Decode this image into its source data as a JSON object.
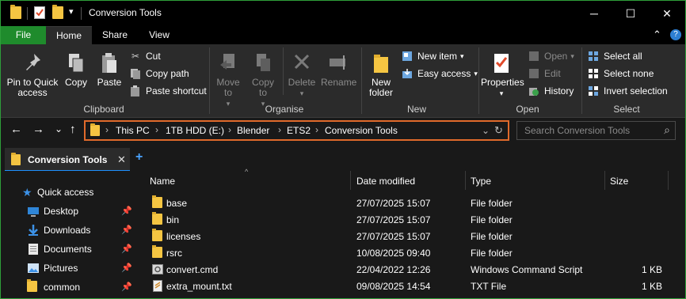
{
  "window": {
    "title": "Conversion Tools",
    "accent": "#2e9e3a",
    "controls": {
      "minimize": "─",
      "maximize": "☐",
      "close": "✕"
    }
  },
  "quick_access_toolbar": {
    "dropdown_glyph": "▾"
  },
  "menu_tabs": [
    {
      "label": "File"
    },
    {
      "label": "Home"
    },
    {
      "label": "Share"
    },
    {
      "label": "View"
    }
  ],
  "ribbon_controls": {
    "collapse_glyph": "⌃",
    "help_glyph": "?"
  },
  "ribbon": {
    "clipboard": {
      "group_label": "Clipboard",
      "pin_label": "Pin to Quick access",
      "copy_label": "Copy",
      "paste_label": "Paste",
      "cut_label": "Cut",
      "copy_path_label": "Copy path",
      "paste_shortcut_label": "Paste shortcut"
    },
    "organise": {
      "group_label": "Organise",
      "move_to_label": "Move to",
      "copy_to_label": "Copy to",
      "delete_label": "Delete",
      "rename_label": "Rename"
    },
    "new": {
      "group_label": "New",
      "new_folder_label": "New folder",
      "new_item_label": "New item",
      "easy_access_label": "Easy access"
    },
    "open": {
      "group_label": "Open",
      "properties_label": "Properties",
      "open_label": "Open",
      "edit_label": "Edit",
      "history_label": "History"
    },
    "select": {
      "group_label": "Select",
      "select_all_label": "Select all",
      "select_none_label": "Select none",
      "invert_label": "Invert selection"
    }
  },
  "address": {
    "crumbs": [
      "This PC",
      "1TB HDD (E:)",
      "Blender",
      "ETS2",
      "Conversion Tools"
    ],
    "separator": "›",
    "highlight_color": "#e06a2b"
  },
  "nav_buttons": {
    "back": "←",
    "forward": "→",
    "recent": "⌄",
    "up": "↑",
    "dropdown": "⌄",
    "refresh": "↻"
  },
  "search": {
    "placeholder": "Search Conversion Tools",
    "icon": "⌕"
  },
  "folder_tab": {
    "label": "Conversion Tools",
    "close_glyph": "✕",
    "new_tab_glyph": "+"
  },
  "nav_pane": {
    "pin_glyph": "📌",
    "items": [
      {
        "label": "Quick access",
        "icon": "star-icon",
        "pinned": false
      },
      {
        "label": "Desktop",
        "icon": "desktop-icon",
        "pinned": true
      },
      {
        "label": "Downloads",
        "icon": "download-icon",
        "pinned": true
      },
      {
        "label": "Documents",
        "icon": "documents-icon",
        "pinned": true
      },
      {
        "label": "Pictures",
        "icon": "pictures-icon",
        "pinned": true
      },
      {
        "label": "common",
        "icon": "folder-icon",
        "pinned": true
      }
    ]
  },
  "file_list": {
    "columns": {
      "name": "Name",
      "date": "Date modified",
      "type": "Type",
      "size": "Size"
    },
    "sort_glyph": "^",
    "rows": [
      {
        "name": "base",
        "date": "27/07/2025 15:07",
        "type": "File folder",
        "size": "",
        "icon": "folder-icon"
      },
      {
        "name": "bin",
        "date": "27/07/2025 15:07",
        "type": "File folder",
        "size": "",
        "icon": "folder-icon"
      },
      {
        "name": "licenses",
        "date": "27/07/2025 15:07",
        "type": "File folder",
        "size": "",
        "icon": "folder-icon"
      },
      {
        "name": "rsrc",
        "date": "10/08/2025 09:40",
        "type": "File folder",
        "size": "",
        "icon": "folder-icon"
      },
      {
        "name": "convert.cmd",
        "date": "22/04/2022 12:26",
        "type": "Windows Command Script",
        "size": "1 KB",
        "icon": "cmd-script-icon"
      },
      {
        "name": "extra_mount.txt",
        "date": "09/08/2025 14:54",
        "type": "TXT File",
        "size": "1 KB",
        "icon": "text-file-icon"
      }
    ]
  }
}
